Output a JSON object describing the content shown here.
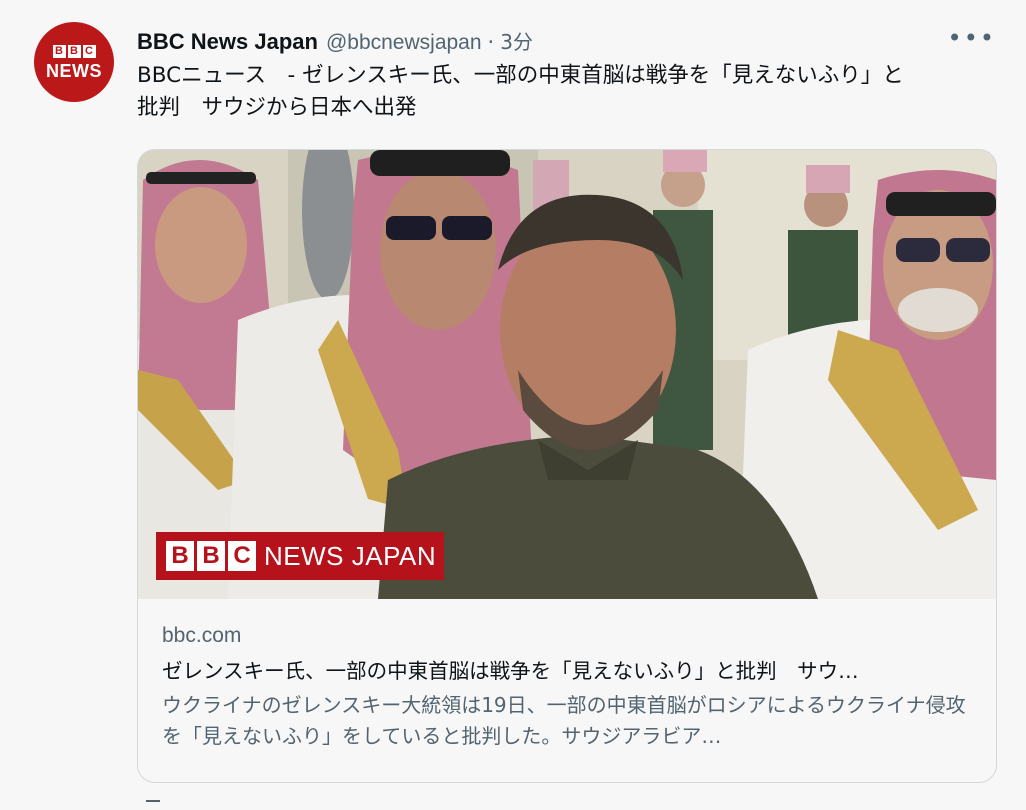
{
  "tweet": {
    "display_name": "BBC News Japan",
    "handle": "@bbcnewsjapan",
    "separator": "·",
    "time": "3分",
    "more_label": "•••",
    "text": "BBCニュース　- ゼレンスキー氏、一部の中東首脳は戦争を「見えないふり」と\n批判　サウジから日本へ出発"
  },
  "avatar": {
    "letters": [
      "B",
      "B",
      "C"
    ],
    "word": "NEWS"
  },
  "card": {
    "watermark_letters": [
      "B",
      "B",
      "C"
    ],
    "watermark_text": "NEWS JAPAN",
    "domain": "bbc.com",
    "title": "ゼレンスキー氏、一部の中東首脳は戦争を「見えないふり」と批判　サウ…",
    "description": "ウクライナのゼレンスキー大統領は19日、一部の中東首脳がロシアによるウクライナ侵攻を「見えないふり」をしていると批判した。サウジアラビア…"
  },
  "colors": {
    "bbc_red": "#bb1919",
    "secondary_text": "#536471"
  }
}
